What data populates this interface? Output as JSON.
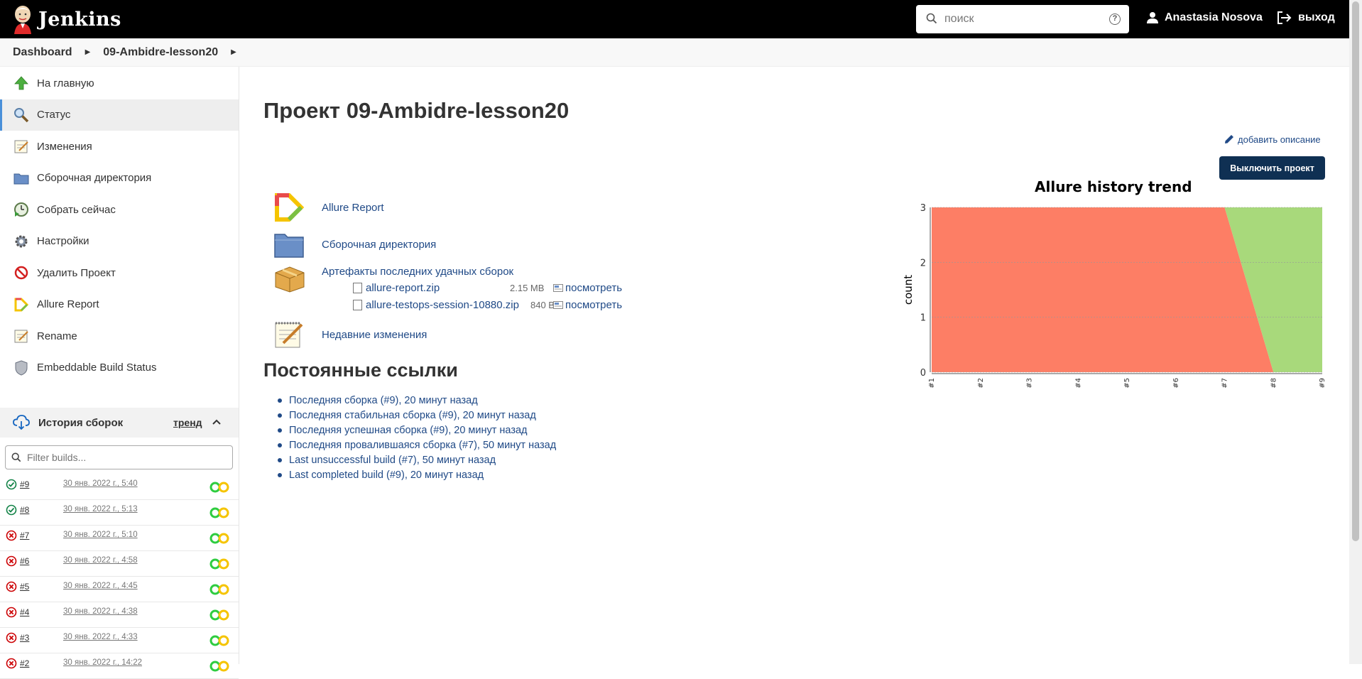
{
  "header": {
    "logo_text": "Jenkins",
    "search_placeholder": "поиск",
    "user_name": "Anastasia Nosova",
    "logout_label": "выход"
  },
  "breadcrumbs": [
    "Dashboard",
    "09-Ambidre-lesson20"
  ],
  "sidebar": {
    "items": [
      {
        "label": "На главную",
        "icon": "up-arrow-icon"
      },
      {
        "label": "Статус",
        "icon": "magnifier-icon"
      },
      {
        "label": "Изменения",
        "icon": "notepad-icon"
      },
      {
        "label": "Сборочная директория",
        "icon": "folder-icon"
      },
      {
        "label": "Собрать сейчас",
        "icon": "clock-play-icon"
      },
      {
        "label": "Настройки",
        "icon": "gear-icon"
      },
      {
        "label": "Удалить Проект",
        "icon": "no-entry-icon"
      },
      {
        "label": "Allure Report",
        "icon": "allure-icon"
      },
      {
        "label": "Rename",
        "icon": "notepad-icon"
      },
      {
        "label": "Embeddable Build Status",
        "icon": "shield-icon"
      }
    ],
    "build_history": {
      "title": "История сборок",
      "trend_label": "тренд",
      "filter_placeholder": "Filter builds...",
      "builds": [
        {
          "num": "#9",
          "date": "30 янв. 2022 г., 5:40",
          "status": "success"
        },
        {
          "num": "#8",
          "date": "30 янв. 2022 г., 5:13",
          "status": "success"
        },
        {
          "num": "#7",
          "date": "30 янв. 2022 г., 5:10",
          "status": "failed"
        },
        {
          "num": "#6",
          "date": "30 янв. 2022 г., 4:58",
          "status": "failed"
        },
        {
          "num": "#5",
          "date": "30 янв. 2022 г., 4:45",
          "status": "failed"
        },
        {
          "num": "#4",
          "date": "30 янв. 2022 г., 4:38",
          "status": "failed"
        },
        {
          "num": "#3",
          "date": "30 янв. 2022 г., 4:33",
          "status": "failed"
        },
        {
          "num": "#2",
          "date": "30 янв. 2022 г., 14:22",
          "status": "failed"
        }
      ]
    }
  },
  "main": {
    "title": "Проект 09-Ambidre-lesson20",
    "add_description": "добавить описание",
    "disable_button": "Выключить проект",
    "links": {
      "allure": "Allure Report",
      "workspace": "Сборочная директория",
      "artifacts_title": "Артефакты последних удачных сборок",
      "recent_changes": "Недавние изменения"
    },
    "artifacts": [
      {
        "name": "allure-report.zip",
        "size": "2.15 MB",
        "view": "посмотреть"
      },
      {
        "name": "allure-testops-session-10880.zip",
        "size": "840 B",
        "view": "посмотреть"
      }
    ],
    "permalinks_title": "Постоянные ссылки",
    "permalinks": [
      "Последняя сборка (#9), 20 минут назад",
      "Последняя стабильная сборка (#9), 20 минут назад",
      "Последняя успешная сборка (#9), 20 минут назад",
      "Последняя провалившаяся сборка (#7), 50 минут назад",
      "Last unsuccessful build (#7), 50 минут назад",
      "Last completed build (#9), 20 минут назад"
    ]
  },
  "chart_data": {
    "type": "area",
    "title": "Allure history trend",
    "xlabel": "",
    "ylabel": "count",
    "x": [
      "#1",
      "#2",
      "#3",
      "#4",
      "#5",
      "#6",
      "#7",
      "#8",
      "#9"
    ],
    "ylim": [
      0,
      3
    ],
    "yticks": [
      0,
      1,
      2,
      3
    ],
    "series": [
      {
        "values": [
          3,
          3,
          3,
          3,
          3,
          3,
          3,
          0,
          0
        ],
        "color": "#fd7e65"
      },
      {
        "values": [
          0,
          0,
          0,
          0,
          0,
          0,
          0,
          3,
          3
        ],
        "color": "#a8d97b"
      }
    ],
    "grid": true
  },
  "colors": {
    "header_bg": "#000000",
    "link": "#204a87",
    "button_bg": "#0f3053",
    "failed_series": "#fd7e65",
    "passed_series": "#a8d97b"
  }
}
